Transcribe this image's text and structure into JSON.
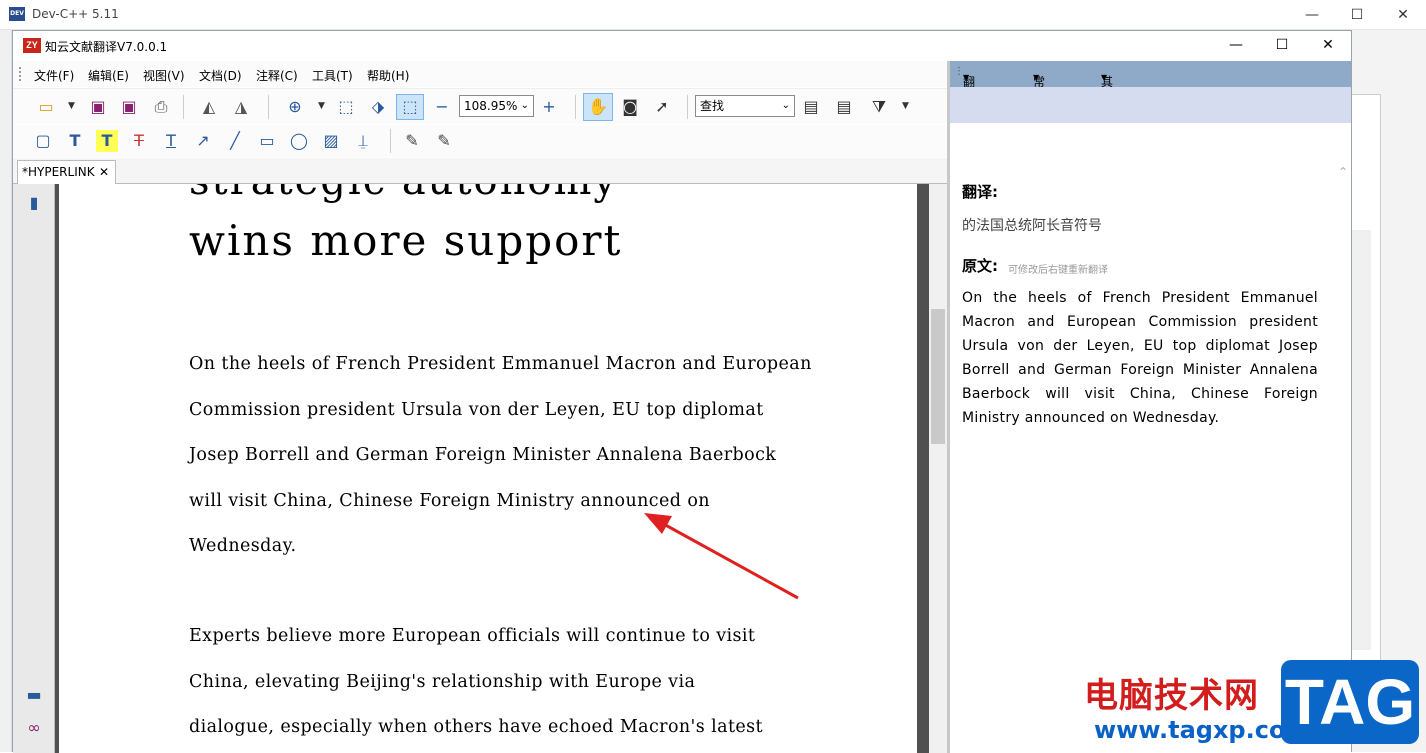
{
  "outer_window": {
    "title": "Dev-C++ 5.11",
    "icon_text": "DEV C++"
  },
  "window": {
    "title": "知云文献翻译V7.0.0.1",
    "logo_text": "ZY",
    "menu": [
      "文件(F)",
      "编辑(E)",
      "视图(V)",
      "文档(D)",
      "注释(C)",
      "工具(T)",
      "帮助(H)"
    ],
    "zoom": "108.95%",
    "search_placeholder": "查找",
    "tab_label": "*HYPERLINK"
  },
  "document": {
    "heading_line1": "strategic autonomy",
    "heading_line2": "wins more support",
    "paragraph1": [
      "On the heels of French President Emmanuel Macron and European",
      "Commission president Ursula von der Leyen, EU top diplomat",
      "Josep Borrell and German Foreign Minister Annalena Baerbock",
      "will visit China, Chinese Foreign Ministry announced on",
      "Wednesday."
    ],
    "paragraph2": [
      "Experts believe more European officials will continue to visit",
      "China, elevating Beijing's relationship with Europe via",
      "dialogue, especially when others have echoed Macron's latest"
    ]
  },
  "translation_panel": {
    "menu": [
      "翻译引擎",
      "常用链接",
      "其他功能"
    ],
    "translation_heading": "翻译:",
    "translation_text": "的法国总统阿长音符号",
    "original_heading": "原文:",
    "original_hint": "可修改后右键重新翻译",
    "original_text": "On the heels of French President Emmanuel Macron and European Commission president Ursula von der Leyen, EU top diplomat Josep Borrell and German Foreign Minister Annalena Baerbock will visit China, Chinese Foreign Ministry announced on Wednesday."
  },
  "watermark": {
    "site_name": "电脑技术网",
    "url": "www.tagxp.com",
    "tag": "TAG"
  },
  "colors": {
    "panel_menu_bg": "#8fa9c8",
    "panel_band": "#d5dcef",
    "arrow": "#e02020"
  }
}
